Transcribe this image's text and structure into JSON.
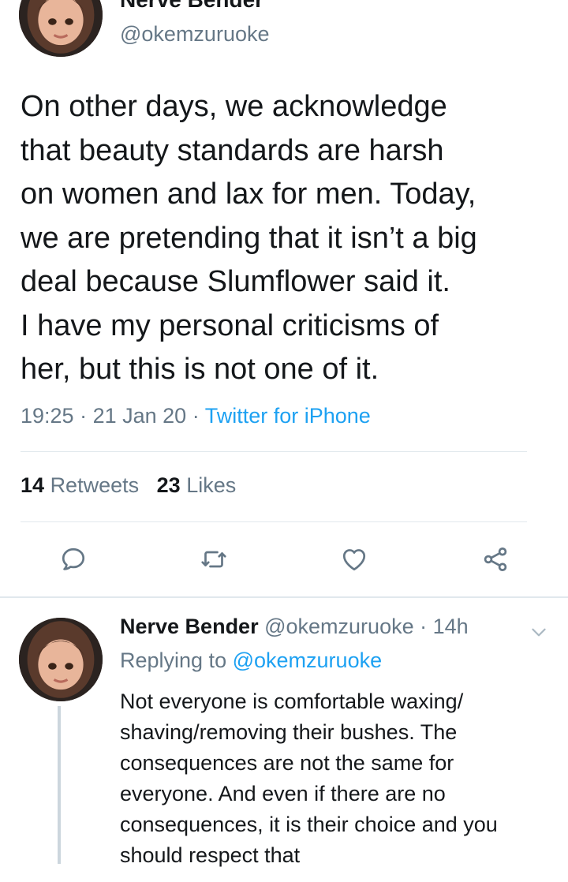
{
  "tweet": {
    "author_name": "Nerve Bender",
    "handle": "@okemzuruoke",
    "text": "On other days, we acknowledge\nthat beauty standards are harsh\non women and lax for men. Today,\nwe are pretending that it isn’t a big\ndeal because Slumflower said it.\nI have my personal criticisms of\nher, but this is not one of it.",
    "time": "19:25",
    "date": "21 Jan 20",
    "source": "Twitter for iPhone",
    "separator": " · ",
    "retweets_count": "14",
    "retweets_label": "Retweets",
    "likes_count": "23",
    "likes_label": "Likes"
  },
  "actions": {
    "reply_icon": "reply-icon",
    "retweet_icon": "retweet-icon",
    "like_icon": "heart-icon",
    "share_icon": "share-icon"
  },
  "reply": {
    "author_name": "Nerve Bender",
    "handle": "@okemzuruoke",
    "time_ago": "14h",
    "replying_label": "Replying to",
    "replying_to": "@okemzuruoke",
    "text": "Not everyone is comfortable waxing/\nshaving/removing their bushes. The\nconsequences are not the same for\neveryone. And even if there are no\nconsequences, it is their choice and you\nshould respect that"
  },
  "colors": {
    "text": "#14171a",
    "secondary": "#657786",
    "link": "#1da1f2",
    "divider": "#e1e8ed"
  }
}
